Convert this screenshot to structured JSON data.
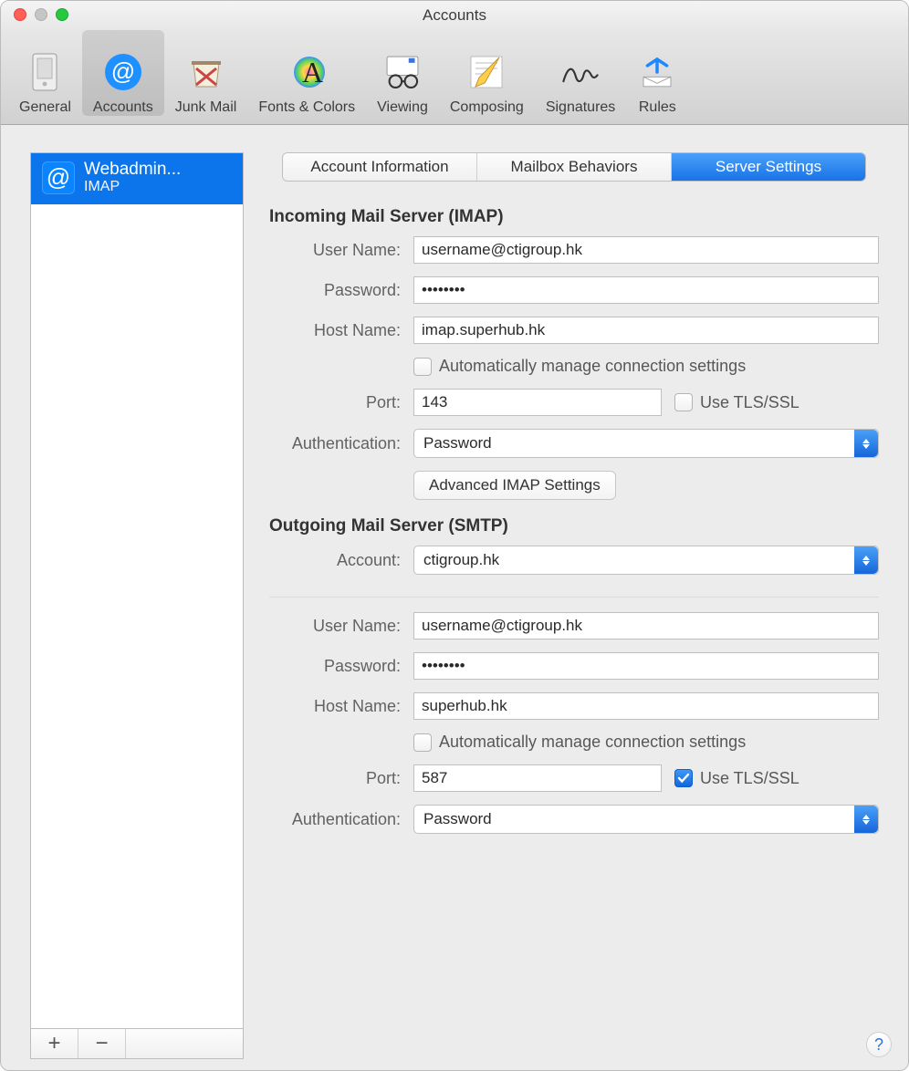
{
  "window": {
    "title": "Accounts"
  },
  "toolbar": [
    {
      "id": "general",
      "label": "General"
    },
    {
      "id": "accounts",
      "label": "Accounts"
    },
    {
      "id": "junk",
      "label": "Junk Mail"
    },
    {
      "id": "fonts",
      "label": "Fonts & Colors"
    },
    {
      "id": "viewing",
      "label": "Viewing"
    },
    {
      "id": "composing",
      "label": "Composing"
    },
    {
      "id": "signatures",
      "label": "Signatures"
    },
    {
      "id": "rules",
      "label": "Rules"
    }
  ],
  "toolbar_selected": "accounts",
  "sidebar": {
    "accounts": [
      {
        "name": "Webadmin...",
        "type": "IMAP"
      }
    ],
    "add_label": "+",
    "remove_label": "−"
  },
  "tabs": {
    "info": "Account Information",
    "behaviors": "Mailbox Behaviors",
    "server": "Server Settings",
    "active": "server"
  },
  "incoming": {
    "heading": "Incoming Mail Server (IMAP)",
    "labels": {
      "user": "User Name:",
      "pass": "Password:",
      "host": "Host Name:",
      "auto": "Automatically manage connection settings",
      "port": "Port:",
      "tls": "Use TLS/SSL",
      "auth": "Authentication:",
      "advanced_btn": "Advanced IMAP Settings"
    },
    "user": "username@ctigroup.hk",
    "pass": "••••••••",
    "host": "imap.superhub.hk",
    "auto_checked": false,
    "port": "143",
    "tls_checked": false,
    "auth": "Password"
  },
  "outgoing": {
    "heading": "Outgoing Mail Server (SMTP)",
    "labels": {
      "account": "Account:",
      "user": "User Name:",
      "pass": "Password:",
      "host": "Host Name:",
      "auto": "Automatically manage connection settings",
      "port": "Port:",
      "tls": "Use TLS/SSL",
      "auth": "Authentication:"
    },
    "account": "ctigroup.hk",
    "user": "username@ctigroup.hk",
    "pass": "••••••••",
    "host": "superhub.hk",
    "auto_checked": false,
    "port": "587",
    "tls_checked": true,
    "auth": "Password"
  },
  "help_label": "?"
}
